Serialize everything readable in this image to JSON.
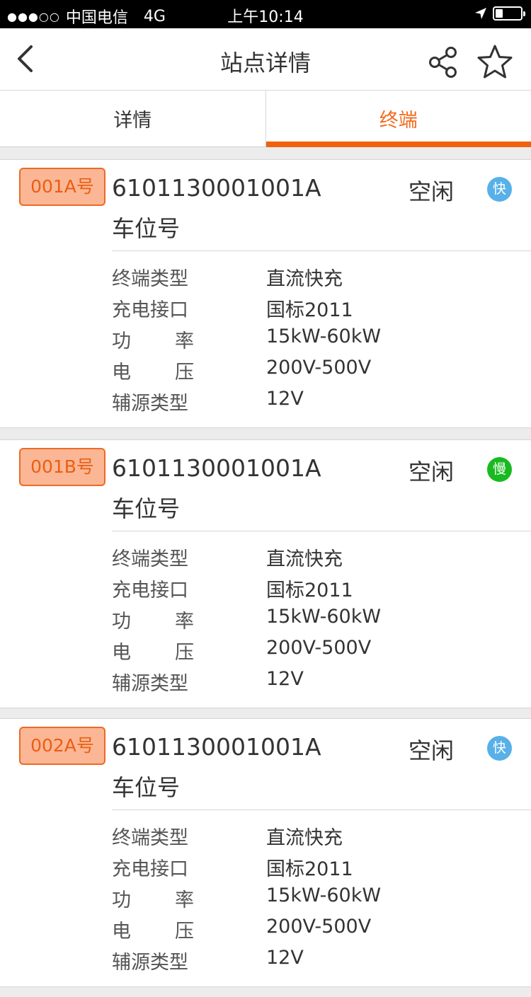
{
  "status_bar": {
    "signal": "●●●○○",
    "carrier": "中国电信",
    "network": "4G",
    "time": "上午10:14"
  },
  "nav": {
    "title": "站点详情",
    "icons": [
      "back-arrow-icon",
      "share-icon",
      "star-icon"
    ]
  },
  "tabs": [
    {
      "label": "详情",
      "active": false
    },
    {
      "label": "终端",
      "active": true
    }
  ],
  "spec_labels": {
    "type": "终端类型",
    "connector": "充电接口",
    "power_a": "功",
    "power_b": "率",
    "voltage_a": "电",
    "voltage_b": "压",
    "aux": "辅源类型"
  },
  "terminals": [
    {
      "badge": "001A号",
      "code": "6101130001001A",
      "sub_label": "车位号",
      "status": "空闲",
      "speed": "快",
      "type": "直流快充",
      "connector": "国标2011",
      "power": "15kW-60kW",
      "voltage": "200V-500V",
      "aux": "12V"
    },
    {
      "badge": "001B号",
      "code": "6101130001001A",
      "sub_label": "车位号",
      "status": "空闲",
      "speed": "慢",
      "type": "直流快充",
      "connector": "国标2011",
      "power": "15kW-60kW",
      "voltage": "200V-500V",
      "aux": "12V"
    },
    {
      "badge": "002A号",
      "code": "6101130001001A",
      "sub_label": "车位号",
      "status": "空闲",
      "speed": "快",
      "type": "直流快充",
      "connector": "国标2011",
      "power": "15kW-60kW",
      "voltage": "200V-500V",
      "aux": "12V"
    }
  ],
  "colors": {
    "accent": "#f0620e",
    "badge_bg": "#fbb795",
    "fast": "#58b0e8",
    "slow": "#18ba1f"
  }
}
